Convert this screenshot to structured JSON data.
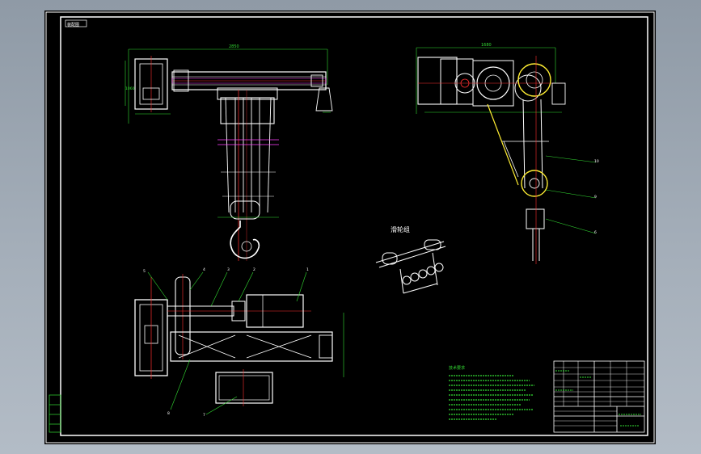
{
  "drawing": {
    "title_tag": "装配图",
    "pulley_group_label": "滑轮组",
    "tech_req_title": "技术要求",
    "dim_width": "2850",
    "dim_top_right": "1680",
    "callouts": [
      "5",
      "4",
      "3",
      "2",
      "1",
      "8",
      "7",
      "10",
      "9",
      "6"
    ]
  },
  "colors": {
    "background": "#000000",
    "frame": "#ffffff",
    "geometry": "#ffffff",
    "centerline": "#ff3030",
    "dimension": "#33dd33",
    "hidden": "#ff40ff",
    "highlight": "#ffee33",
    "annotation": "#33dd33"
  }
}
